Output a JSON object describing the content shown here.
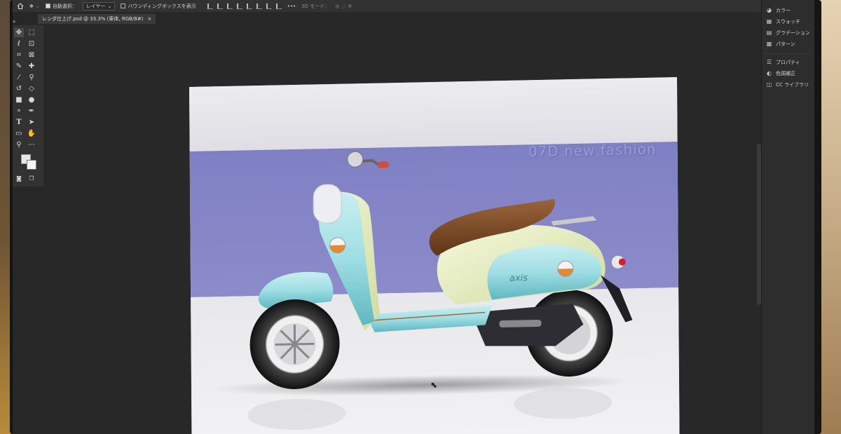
{
  "options_bar": {
    "home_icon": "home-icon",
    "move_icon": "move-icon",
    "auto_select_label": "自動選択：",
    "auto_select_target": "レイヤー",
    "bounding_box_label": "バウンディングボックスを表示",
    "more_label": "•••",
    "mode_3d_label": "3D モード："
  },
  "document": {
    "tab_title": "レンダ仕上げ.psd @ 33.3% (車体, RGB/8#)",
    "close_label": "×"
  },
  "toolbar": {
    "collapse_label": "«",
    "tools": [
      "move",
      "marquee",
      "lasso",
      "object-select",
      "crop",
      "frame",
      "eyedropper",
      "healing",
      "brush",
      "stamp",
      "history-brush",
      "eraser",
      "gradient",
      "blur",
      "dodge",
      "pen",
      "text",
      "path-select",
      "rectangle",
      "hand",
      "zoom",
      "more-tools"
    ]
  },
  "artboard": {
    "caption": "07D new fashion",
    "badge": "axis",
    "colors": {
      "band": "#8586c8",
      "body_teal": "#9fdee4",
      "body_cream": "#e6eec0",
      "seat": "#7a4a22"
    }
  },
  "panels": {
    "items": [
      {
        "icon": "palette-icon",
        "label": "カラー"
      },
      {
        "icon": "swatches-icon",
        "label": "スウォッチ"
      },
      {
        "icon": "gradient-icon",
        "label": "グラデーション"
      },
      {
        "icon": "pattern-icon",
        "label": "パターン"
      },
      {
        "icon": "properties-icon",
        "label": "プロパティ"
      },
      {
        "icon": "adjustments-icon",
        "label": "色調補正"
      },
      {
        "icon": "libraries-icon",
        "label": "CC ライブラリ"
      }
    ]
  }
}
